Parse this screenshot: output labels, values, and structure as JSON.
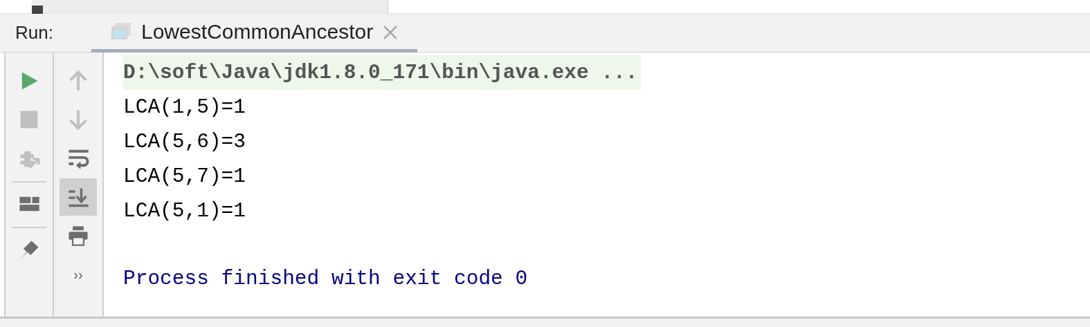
{
  "run_panel": {
    "label": "Run:"
  },
  "tabs": [
    {
      "label": "LowestCommonAncestor",
      "selected": true
    }
  ],
  "left_toolbar": [
    {
      "kind": "run",
      "disabled": false
    },
    {
      "kind": "stop",
      "disabled": true
    },
    {
      "kind": "debug-exit",
      "disabled": true
    },
    {
      "kind": "divider"
    },
    {
      "kind": "layout",
      "disabled": false
    },
    {
      "kind": "divider"
    },
    {
      "kind": "pin",
      "disabled": false
    }
  ],
  "right_toolbar": [
    {
      "kind": "up",
      "disabled": true,
      "toggled": false
    },
    {
      "kind": "down",
      "disabled": true,
      "toggled": false
    },
    {
      "kind": "wrap",
      "disabled": false,
      "toggled": false
    },
    {
      "kind": "scroll-end",
      "disabled": false,
      "toggled": true
    },
    {
      "kind": "print",
      "disabled": false,
      "toggled": false
    },
    {
      "kind": "more",
      "text": "››"
    }
  ],
  "console": [
    {
      "kind": "command",
      "text": "D:\\soft\\Java\\jdk1.8.0_171\\bin\\java.exe ..."
    },
    {
      "kind": "output",
      "text": "LCA(1,5)=1"
    },
    {
      "kind": "output",
      "text": "LCA(5,6)=3"
    },
    {
      "kind": "output",
      "text": "LCA(5,7)=1"
    },
    {
      "kind": "output",
      "text": "LCA(5,1)=1"
    },
    {
      "kind": "system",
      "text": "Process finished with exit code 0"
    }
  ]
}
